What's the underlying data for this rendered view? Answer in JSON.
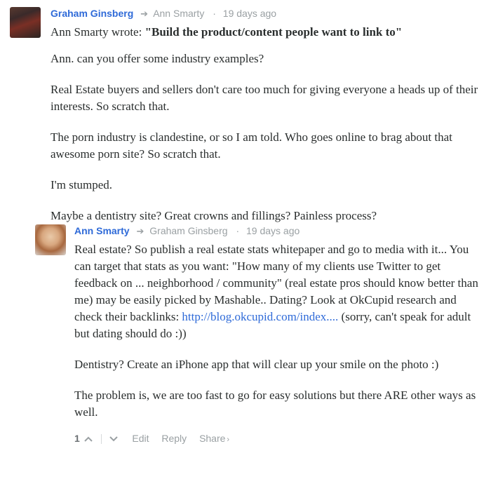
{
  "comments": [
    {
      "author": "Graham Ginsberg",
      "reply_to": "Ann Smarty",
      "time": "19 days ago",
      "quote_prefix": "Ann Smarty wrote: ",
      "quote": "\"Build the product/content people want to link to\"",
      "paragraphs": [
        "Ann. can you offer some industry examples?",
        "Real Estate buyers and sellers don't care too much for giving everyone a heads up of their interests. So scratch that.",
        "The porn industry is clandestine, or so I am told. Who goes online to brag about that awesome porn site? So scratch that.",
        "I'm stumped.",
        "Maybe a dentistry site? Great crowns and fillings? Painless process?"
      ]
    },
    {
      "author": "Ann Smarty",
      "reply_to": "Graham Ginsberg",
      "time": "19 days ago",
      "p1_text": "Real estate? So publish a real estate stats whitepaper and go to media with it... You can target that stats as you want: \"How many of my clients use Twitter to get feedback on ... neighborhood / community\" (real estate pros should know better than me) may be easily picked by Mashable.. Dating? Look at OkCupid research and check their backlinks: ",
      "p1_link": "http://blog.okcupid.com/index....",
      "p1_tail": " (sorry, can't speak for adult but dating should do :))",
      "p2": "Dentistry? Create an iPhone app that will clear up your smile on the photo :)",
      "p3": "The problem is, we are too fast to go for easy solutions but there ARE other ways as well.",
      "footer": {
        "votes": "1",
        "edit": "Edit",
        "reply": "Reply",
        "share": "Share"
      }
    }
  ],
  "icons": {
    "reply_arrow": "arrow-right-icon",
    "upvote": "chevron-up-icon",
    "downvote": "chevron-down-icon",
    "share_arrow": "chevron-right-icon"
  },
  "colors": {
    "link": "#2e6ad8",
    "muted": "#9aa0a3",
    "text": "#2a2e2e"
  }
}
